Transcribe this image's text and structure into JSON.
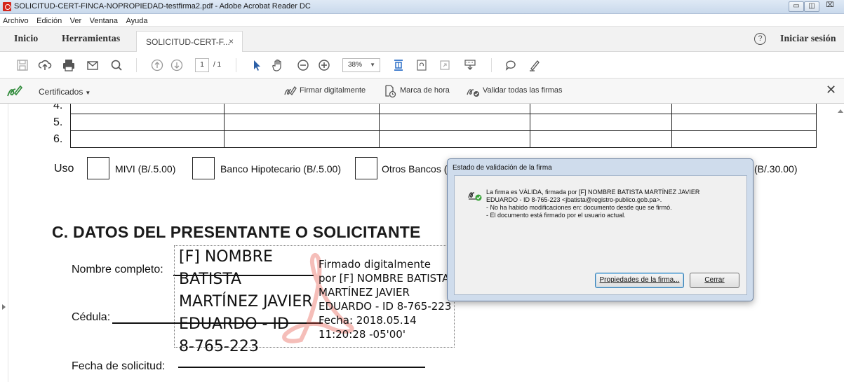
{
  "window": {
    "title": "SOLICITUD-CERT-FINCA-NOPROPIEDAD-testfirma2.pdf - Adobe Acrobat Reader DC"
  },
  "menu": [
    "Archivo",
    "Edición",
    "Ver",
    "Ventana",
    "Ayuda"
  ],
  "tabs": {
    "home": "Inicio",
    "tools": "Herramientas",
    "document": "SOLICITUD-CERT-F...",
    "close_symbol": "×",
    "help_symbol": "?",
    "sign_in": "Iniciar sesión"
  },
  "toolbar": {
    "page_current": "1",
    "page_total": "/ 1",
    "zoom": "38%"
  },
  "cert_bar": {
    "label": "Certificados",
    "sign_digitally": "Firmar digitalmente",
    "timestamp": "Marca de hora",
    "validate_all": "Validar todas las firmas"
  },
  "document": {
    "row_numbers": [
      "4.",
      "5.",
      "6."
    ],
    "uso_label": "Uso",
    "options": [
      "MIVI (B/.5.00)",
      "Banco Hipotecario (B/.5.00)",
      "Otros Bancos (",
      "(B/.30.00)"
    ],
    "section_title": "C.  DATOS DEL PRESENTANTE O SOLICITANTE",
    "fields": {
      "full_name": "Nombre completo:",
      "id_number": "Cédula:",
      "request_date": "Fecha de solicitud:"
    },
    "signature": {
      "name_large": "[F] NOMBRE\nBATISTA\nMARTÍNEZ JAVIER\nEDUARDO - ID\n8-765-223",
      "details": "Firmado digitalmente\npor [F] NOMBRE BATISTA\nMARTÍNEZ JAVIER\nEDUARDO - ID 8-765-223\nFecha: 2018.05.14\n11:20:28 -05'00'"
    }
  },
  "dialog": {
    "title": "Estado de validación de la firma",
    "line1": "La firma es VÁLIDA, firmada por [F] NOMBRE BATISTA MARTÍNEZ JAVIER",
    "line2": "EDUARDO - ID 8-765-223 <jbatista@registro-publico.gob.pa>.",
    "line3": "- No ha habido modificaciones en: documento desde que se firmó.",
    "line4": "- El documento está firmado por el usuario actual.",
    "properties_button": "Propiedades de la firma...",
    "close_button": "Cerrar"
  }
}
